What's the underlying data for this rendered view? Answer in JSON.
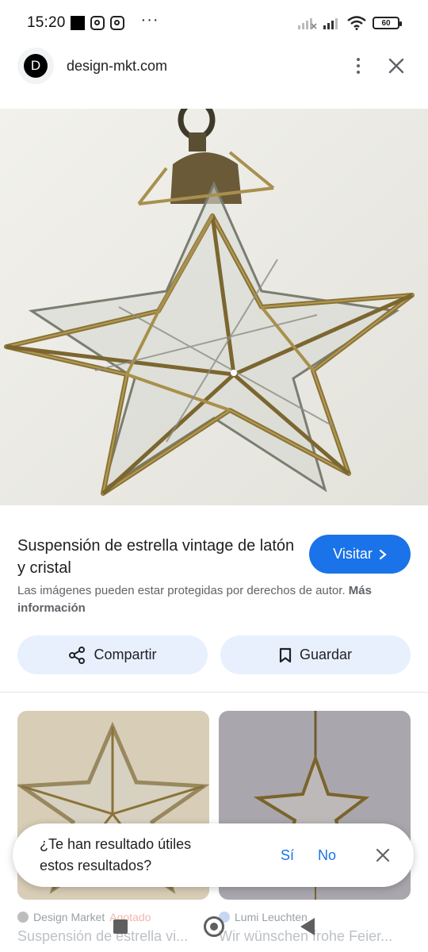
{
  "status_bar": {
    "time": "15:20",
    "battery": "60"
  },
  "top_bar": {
    "logo_letter": "D",
    "domain": "design-mkt.com"
  },
  "result": {
    "title": "Suspensión de estrella vintage de latón y cristal",
    "visit_label": "Visitar",
    "copyright_text": "Las imágenes pueden estar protegidas por derechos de autor.",
    "copyright_link": "Más información"
  },
  "actions": {
    "share_label": "Compartir",
    "save_label": "Guardar"
  },
  "related": [
    {
      "source": "Design Market",
      "status": "Agotado",
      "title": "Suspensión de estrella vi..."
    },
    {
      "source": "Lumi Leuchten",
      "status": "",
      "title": "Wir wünschen frohe Feier..."
    }
  ],
  "feedback": {
    "question": "¿Te han resultado útiles estos resultados?",
    "yes_label": "Sí",
    "no_label": "No"
  },
  "colors": {
    "accent": "#1a73e8",
    "pill_bg": "#e8f0fe"
  },
  "icons": {
    "share": "share-icon",
    "bookmark": "bookmark-icon",
    "close": "close-icon",
    "more": "more-vert-icon",
    "chevron": "chevron-right-icon"
  }
}
